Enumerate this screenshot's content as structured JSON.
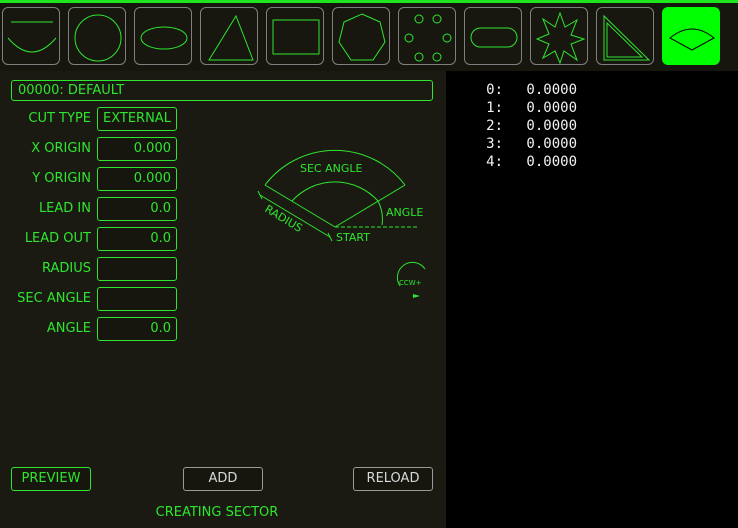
{
  "colors": {
    "accent": "#2ee62e",
    "active": "#00ff00",
    "panel": "#1a1a12",
    "list_bg": "#000000"
  },
  "toolbar": {
    "shapes": [
      {
        "icon": "arc-bowl-icon"
      },
      {
        "icon": "circle-icon"
      },
      {
        "icon": "ellipse-icon"
      },
      {
        "icon": "triangle-icon"
      },
      {
        "icon": "rectangle-icon"
      },
      {
        "icon": "polygon-icon"
      },
      {
        "icon": "bolt-circle-icon"
      },
      {
        "icon": "slot-icon"
      },
      {
        "icon": "star-icon"
      },
      {
        "icon": "right-triangle-icon"
      },
      {
        "icon": "sector-icon",
        "active": true
      }
    ]
  },
  "form": {
    "name": "00000: DEFAULT",
    "cut_type": {
      "label": "CUT TYPE",
      "value": "EXTERNAL"
    },
    "x_origin": {
      "label": "X ORIGIN",
      "value": "0.000"
    },
    "y_origin": {
      "label": "Y ORIGIN",
      "value": "0.000"
    },
    "lead_in": {
      "label": "LEAD IN",
      "value": "0.0"
    },
    "lead_out": {
      "label": "LEAD OUT",
      "value": "0.0"
    },
    "radius": {
      "label": "RADIUS",
      "value": ""
    },
    "sec_angle": {
      "label": "SEC ANGLE",
      "value": ""
    },
    "angle": {
      "label": "ANGLE",
      "value": "0.0"
    }
  },
  "diagram": {
    "sec_angle": "SEC ANGLE",
    "angle": "ANGLE",
    "radius": "RADIUS",
    "start": "START",
    "direction": "CCW+"
  },
  "buttons": {
    "preview": "PREVIEW",
    "add": "ADD",
    "reload": "RELOAD"
  },
  "status": "CREATING SECTOR",
  "gcode_list": [
    {
      "index": "0:",
      "value": "0.0000"
    },
    {
      "index": "1:",
      "value": "0.0000"
    },
    {
      "index": "2:",
      "value": "0.0000"
    },
    {
      "index": "3:",
      "value": "0.0000"
    },
    {
      "index": "4:",
      "value": "0.0000"
    }
  ]
}
